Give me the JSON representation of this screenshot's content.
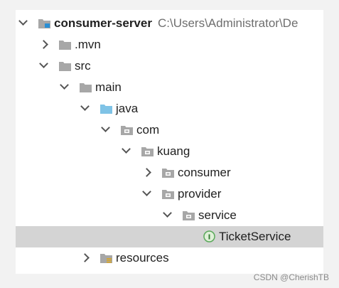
{
  "tree": {
    "rows": [
      {
        "label": "consumer-server",
        "path": "C:\\Users\\Administrator\\De",
        "arrow": "down",
        "icon": "module-folder-icon",
        "level": 0
      },
      {
        "label": ".mvn",
        "arrow": "right",
        "icon": "folder-icon",
        "level": 1
      },
      {
        "label": "src",
        "arrow": "down",
        "icon": "folder-icon",
        "level": 1
      },
      {
        "label": "main",
        "arrow": "down",
        "icon": "folder-icon",
        "level": 2
      },
      {
        "label": "java",
        "arrow": "down",
        "icon": "source-folder-icon",
        "level": 3
      },
      {
        "label": "com",
        "arrow": "down",
        "icon": "package-icon",
        "level": 4
      },
      {
        "label": "kuang",
        "arrow": "down",
        "icon": "package-icon",
        "level": 5
      },
      {
        "label": "consumer",
        "arrow": "right",
        "icon": "package-icon",
        "level": 6
      },
      {
        "label": "provider",
        "arrow": "down",
        "icon": "package-icon",
        "level": 6
      },
      {
        "label": "service",
        "arrow": "down",
        "icon": "package-icon",
        "level": 7
      },
      {
        "label": "TicketService",
        "arrow": "none",
        "icon": "interface-icon",
        "level": 8,
        "selected": true
      },
      {
        "label": "resources",
        "arrow": "right",
        "icon": "resources-folder-icon",
        "level": 3
      }
    ]
  },
  "watermark": "CSDN @CherishTB",
  "colors": {
    "folder": "#a7a7a7",
    "source_folder": "#7fc3e6",
    "module_marker": "#2a8fd4",
    "interface": "#5aa95a",
    "resources_marker": "#d8a72a",
    "selection": "#d4d4d4"
  }
}
